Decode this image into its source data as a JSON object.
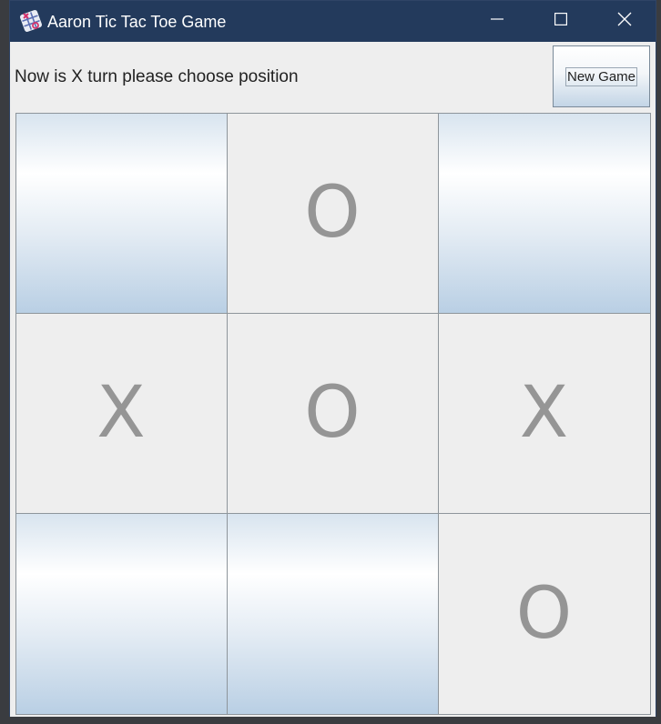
{
  "window": {
    "title": "Aaron Tic Tac Toe Game",
    "icon": "app-tic-tac-toe-icon",
    "controls": [
      "minimize-icon",
      "maximize-icon",
      "close-icon"
    ],
    "titlebar_color": "#233a5c"
  },
  "status": {
    "message": "Now is X turn please choose position"
  },
  "toolbar": {
    "new_game_label": "New Game"
  },
  "board": {
    "cells": [
      [
        "",
        "O",
        ""
      ],
      [
        "X",
        "O",
        "X"
      ],
      [
        "",
        "",
        "O"
      ]
    ],
    "empty_gradient": [
      "#d8e4ef",
      "#ffffff",
      "#b9cfe4"
    ],
    "mark_color": "#959595"
  }
}
